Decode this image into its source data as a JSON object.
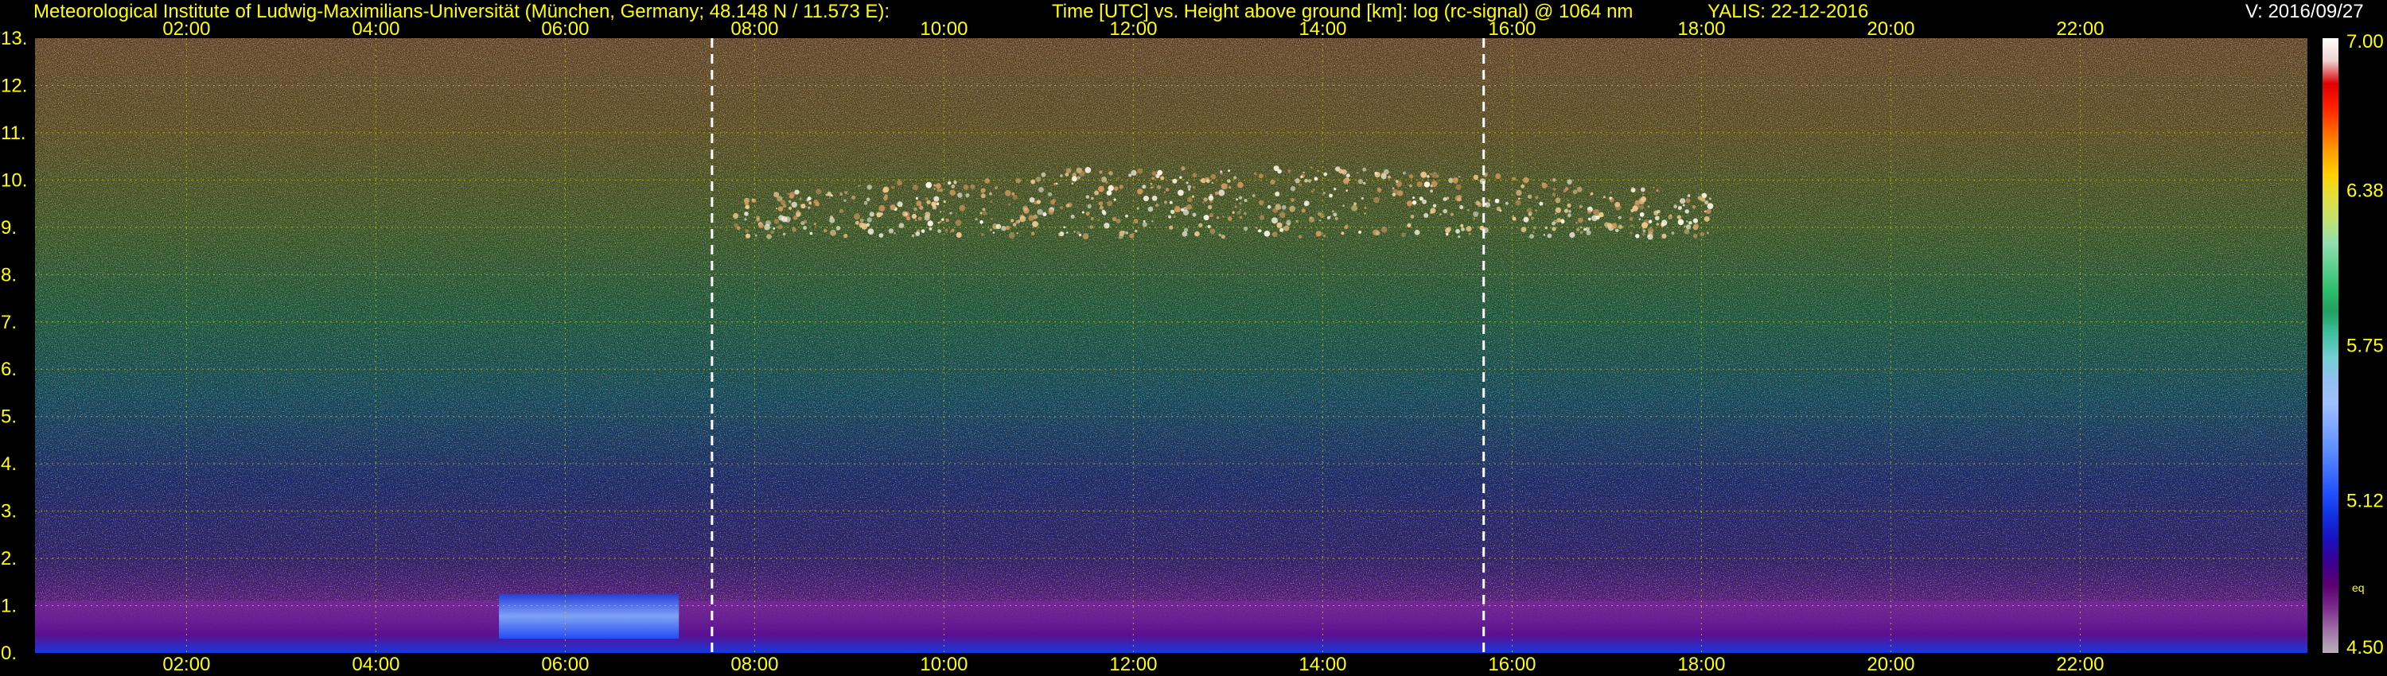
{
  "header": {
    "institute": "Meteorological Institute of Ludwig-Maximilians-Universität (München, Germany; 48.148 N / 11.573 E):",
    "description": "Time [UTC] vs. Height above ground [km]: log (rc-signal) @ 1064 nm",
    "instrument": "YALIS: 22-12-2016",
    "version": "V: 2016/09/27"
  },
  "colors": {
    "text": "#ffff00",
    "grid": "#c8c800",
    "marker": "#ffffff",
    "background": "#000000"
  },
  "chart_data": {
    "type": "heatmap",
    "title": "Time [UTC] vs. Height above ground [km]: log (rc-signal) @ 1064 nm",
    "x_unit": "hour UTC",
    "xlim": [
      0.4,
      24.4
    ],
    "x_ticks": [
      2,
      4,
      6,
      8,
      10,
      12,
      14,
      16,
      18,
      20,
      22
    ],
    "x_tick_labels": [
      "02:00",
      "04:00",
      "06:00",
      "08:00",
      "10:00",
      "12:00",
      "14:00",
      "16:00",
      "18:00",
      "20:00",
      "22:00"
    ],
    "y_unit": "km",
    "ylim": [
      0,
      13
    ],
    "y_ticks": [
      0,
      1,
      2,
      3,
      4,
      5,
      6,
      7,
      8,
      9,
      10,
      11,
      12,
      13
    ],
    "y_tick_labels": [
      "0.",
      "1.",
      "2.",
      "3.",
      "4.",
      "5.",
      "6.",
      "7.",
      "8.",
      "9.",
      "10.",
      "11.",
      "12.",
      "13."
    ],
    "grid": true,
    "vertical_markers_hours": [
      7.55,
      15.7
    ],
    "colorbar": {
      "range": [
        4.5,
        7.0
      ],
      "tick_values": [
        4.5,
        5.12,
        5.75,
        6.38,
        7.0
      ],
      "tick_labels": [
        "4.50",
        "5.12",
        "5.75",
        "6.38",
        "7.00"
      ],
      "unit_label": "eq",
      "colors": [
        "#b8b0b8",
        "#a070a8",
        "#7a2a8a",
        "#5a0070",
        "#3a0090",
        "#1a10c0",
        "#1030e0",
        "#2050ff",
        "#4070ff",
        "#6090ff",
        "#80a8ff",
        "#a0c0ff",
        "#90c0f0",
        "#70d0d0",
        "#40c0a0",
        "#20a060",
        "#30c070",
        "#60d090",
        "#90e0b0",
        "#c0e070",
        "#e0e040",
        "#ffd000",
        "#ffa000",
        "#ff6000",
        "#ff2000",
        "#e00000",
        "#f0d0d0",
        "#ffffff"
      ]
    },
    "features": [
      {
        "name": "cirrus cloud",
        "x": [
          7.8,
          18.1
        ],
        "y": [
          8.8,
          10.3
        ]
      },
      {
        "name": "boundary layer aerosol",
        "x": [
          0.4,
          24.4
        ],
        "y": [
          0,
          1.1
        ]
      },
      {
        "name": "low cloud",
        "x": [
          5.3,
          7.2
        ],
        "y": [
          0.3,
          1.25
        ]
      }
    ]
  }
}
